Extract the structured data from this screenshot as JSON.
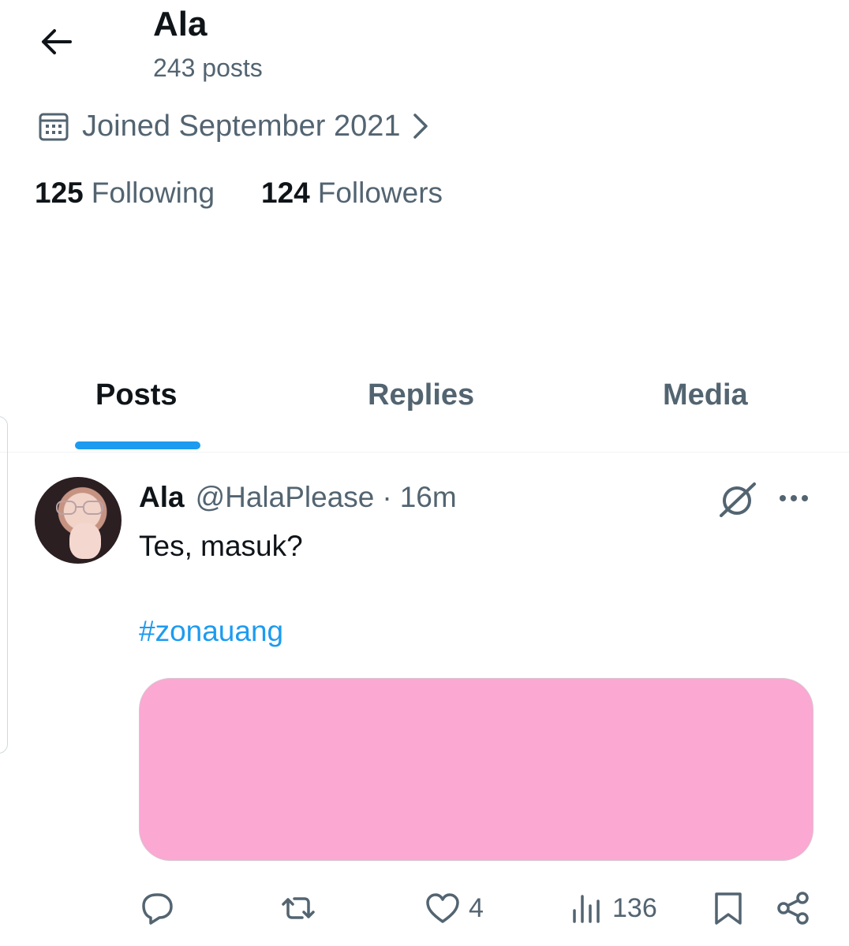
{
  "header": {
    "title": "Ala",
    "post_count": "243 posts"
  },
  "profile": {
    "joined": "Joined September 2021",
    "following_count": "125",
    "following_label": "Following",
    "followers_count": "124",
    "followers_label": "Followers"
  },
  "tabs": [
    {
      "label": "Posts",
      "active": true
    },
    {
      "label": "Replies",
      "active": false
    },
    {
      "label": "Media",
      "active": false
    }
  ],
  "post": {
    "author_name": "Ala",
    "author_handle": "@HalaPlease",
    "separator": "·",
    "time": "16m",
    "text": "Tes, masuk?",
    "hashtag": "#zonauang",
    "media_color": "#fba8d3",
    "actions": {
      "reply_count": "",
      "repost_count": "",
      "like_count": "4",
      "views_count": "136"
    }
  },
  "colors": {
    "accent": "#1d9bf0",
    "text_primary": "#0f1419",
    "text_secondary": "#536471"
  },
  "icons": [
    "back-arrow-icon",
    "calendar-icon",
    "chevron-right-icon",
    "grok-icon",
    "more-icon",
    "reply-icon",
    "repost-icon",
    "like-icon",
    "views-icon",
    "bookmark-icon",
    "share-icon"
  ]
}
